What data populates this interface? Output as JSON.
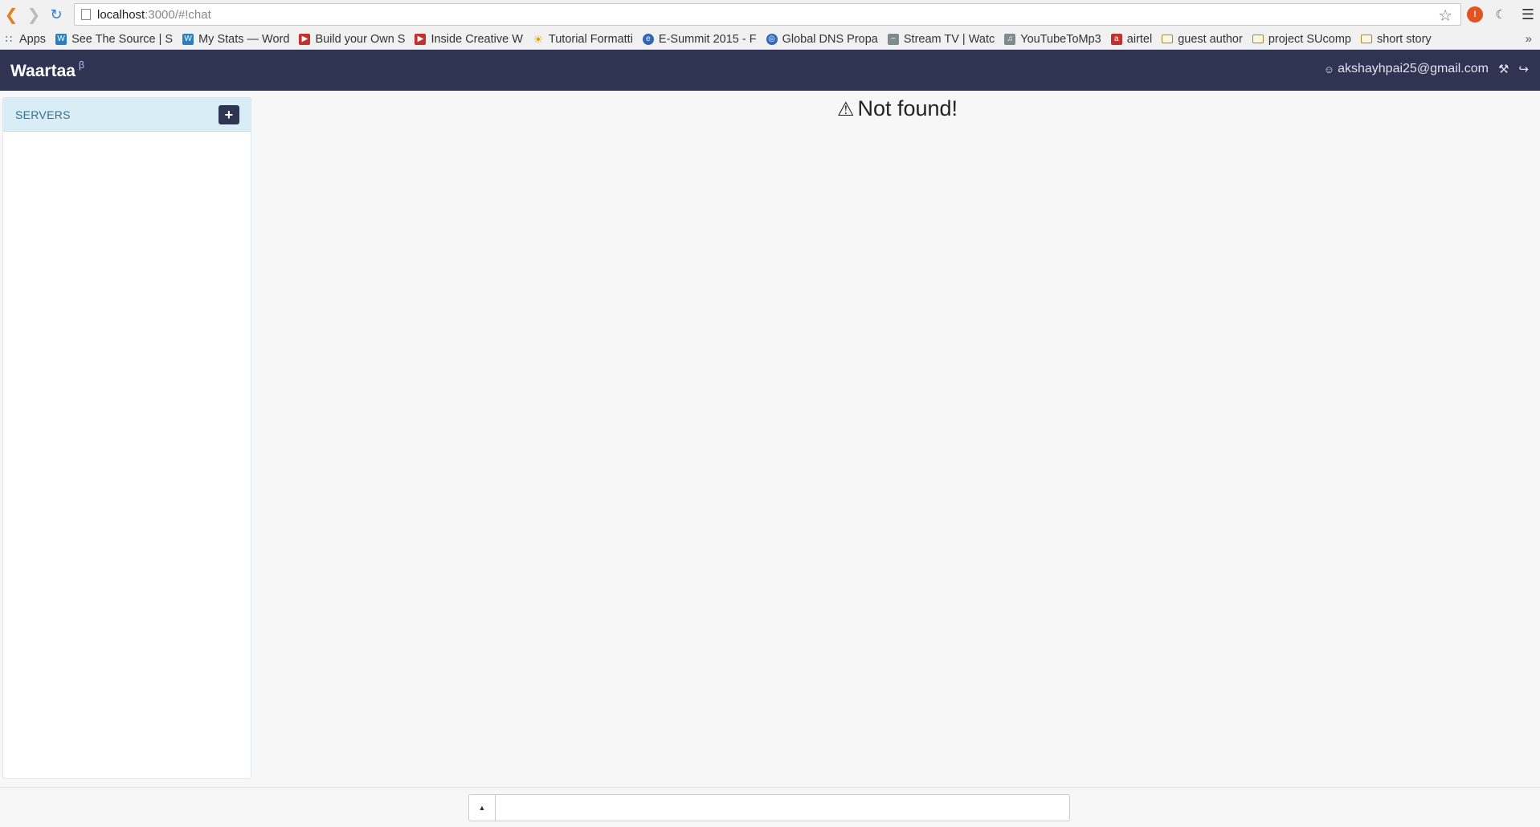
{
  "browser": {
    "url_host": "localhost",
    "url_path": ":3000/#!chat",
    "bookmarks": [
      {
        "label": "Apps",
        "icon": "apps-icon"
      },
      {
        "label": "See The Source | S",
        "icon": "wordpress-icon"
      },
      {
        "label": "My Stats — Word",
        "icon": "wordpress-icon"
      },
      {
        "label": "Build your Own S",
        "icon": "youtube-icon"
      },
      {
        "label": "Inside Creative W",
        "icon": "youtube-icon"
      },
      {
        "label": "Tutorial Formatti",
        "icon": "bulb-icon"
      },
      {
        "label": "E-Summit 2015 - F",
        "icon": "link-icon"
      },
      {
        "label": "Global DNS Propa",
        "icon": "globe-icon"
      },
      {
        "label": "Stream TV | Watc",
        "icon": "stream-icon"
      },
      {
        "label": "YouTubeToMp3",
        "icon": "converter-icon"
      },
      {
        "label": "airtel",
        "icon": "airtel-icon"
      },
      {
        "label": "guest author",
        "icon": "folder-icon"
      },
      {
        "label": "project SUcomp",
        "icon": "folder-icon"
      },
      {
        "label": "short story",
        "icon": "folder-icon"
      }
    ],
    "more_bookmarks": "»"
  },
  "app": {
    "brand": "Waartaa",
    "brand_sup": "β",
    "user_email": "akshayhpai25@gmail.com"
  },
  "sidebar": {
    "title": "SERVERS",
    "add_label": "+"
  },
  "main": {
    "message": "Not found!"
  },
  "footer": {
    "up_label": "▲",
    "input_value": ""
  },
  "colors": {
    "navbar": "#2f3453",
    "sidebar_head": "#d9edf7",
    "sidebar_head_text": "#31708f"
  }
}
